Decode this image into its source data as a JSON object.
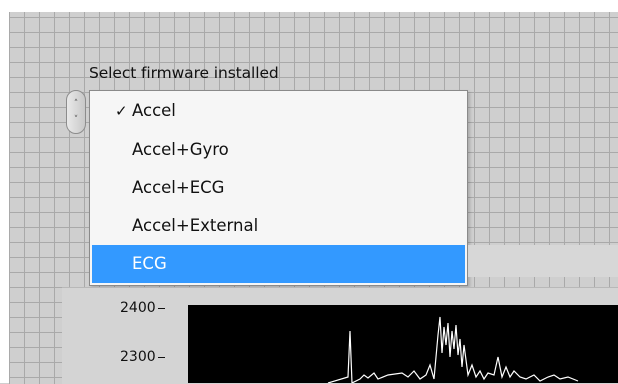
{
  "ring": {
    "label": "Select firmware installed",
    "spin_up_glyph": "˄",
    "spin_down_glyph": "˅"
  },
  "menu": {
    "check_glyph": "✓",
    "items": [
      {
        "label": "Accel",
        "checked": true,
        "highlighted": false
      },
      {
        "label": "Accel+Gyro",
        "checked": false,
        "highlighted": false
      },
      {
        "label": "Accel+ECG",
        "checked": false,
        "highlighted": false
      },
      {
        "label": "Accel+External",
        "checked": false,
        "highlighted": false
      },
      {
        "label": "ECG",
        "checked": false,
        "highlighted": true
      }
    ],
    "highlight_color": "#3399ff"
  },
  "graph": {
    "y_ticks": [
      "2400",
      "2300"
    ],
    "plot_background": "#000000",
    "trace_color": "#ffffff"
  }
}
